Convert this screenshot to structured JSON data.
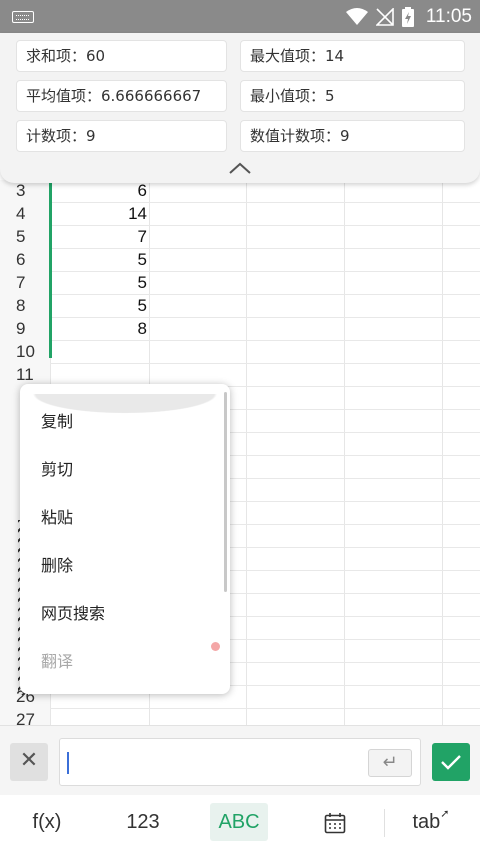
{
  "status_bar": {
    "time": "11:05"
  },
  "summary": {
    "sum": "求和项：60",
    "max": "最大值项：14",
    "average": "平均值项：6.666666667",
    "min": "最小值项：5",
    "count": "计数项：9",
    "numeric_count": "数值计数项：9"
  },
  "rows": [
    {
      "n": "3",
      "v": "6"
    },
    {
      "n": "4",
      "v": "14"
    },
    {
      "n": "5",
      "v": "7"
    },
    {
      "n": "6",
      "v": "5"
    },
    {
      "n": "7",
      "v": "5"
    },
    {
      "n": "8",
      "v": "5"
    },
    {
      "n": "9",
      "v": "8"
    },
    {
      "n": "10",
      "v": ""
    },
    {
      "n": "11",
      "v": ""
    },
    {
      "n": "",
      "v": ""
    },
    {
      "n": "",
      "v": ""
    },
    {
      "n": "",
      "v": ""
    },
    {
      "n": "",
      "v": ""
    },
    {
      "n": "",
      "v": ""
    },
    {
      "n": "",
      "v": ""
    },
    {
      "n": "",
      "v": ""
    },
    {
      "n": "",
      "v": ""
    },
    {
      "n": "",
      "v": ""
    },
    {
      "n": "",
      "v": ""
    },
    {
      "n": "",
      "v": ""
    },
    {
      "n": "",
      "v": ""
    },
    {
      "n": "",
      "v": ""
    },
    {
      "n": "26",
      "v": ""
    },
    {
      "n": "27",
      "v": ""
    }
  ],
  "context_menu": {
    "copy": "复制",
    "cut": "剪切",
    "paste": "粘贴",
    "delete": "删除",
    "web_search": "网页搜索",
    "translate": "翻译"
  },
  "input_bar": {
    "cancel": "✕",
    "enter": "↵"
  },
  "toolbar": {
    "fx": "f(x)",
    "num": "123",
    "abc": "ABC",
    "tab": "tab"
  },
  "colors": {
    "accent": "#21a366",
    "caret": "#3b6fd8"
  }
}
